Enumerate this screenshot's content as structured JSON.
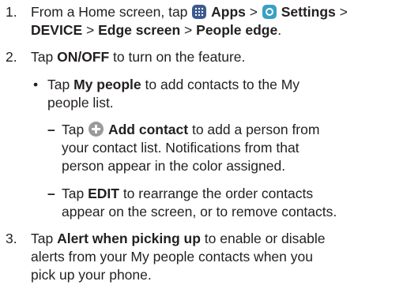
{
  "step1": {
    "number": "1.",
    "t1": "From a Home screen, tap",
    "apps": "Apps",
    "gt1": " > ",
    "settings": "Settings",
    "gt2": " >",
    "device": "DEVICE",
    "gt3": " > ",
    "edge_screen": "Edge screen",
    "gt4": " > ",
    "people_edge": "People edge",
    "period": "."
  },
  "step2": {
    "number": "2.",
    "t1": "Tap ",
    "onoff": "ON/OFF",
    "t2": " to turn on the feature."
  },
  "bullet": {
    "marker": "•",
    "t1": "Tap ",
    "my_people": "My people",
    "t2": " to add contacts to the My",
    "line2": "people list."
  },
  "sub1": {
    "marker": "–",
    "t1": "Tap",
    "add_contact": "Add contact",
    "t2": " to add a person from",
    "line2": "your contact list. Notifications from that",
    "line3": "person appear in the color assigned."
  },
  "sub2": {
    "marker": "–",
    "t1": "Tap ",
    "edit": "EDIT",
    "t2": " to rearrange the order contacts",
    "line2": "appear on the screen, or to remove contacts."
  },
  "step3": {
    "number": "3.",
    "t1": "Tap ",
    "alert": "Alert when picking up",
    "t2": " to enable or disable",
    "line2": "alerts from your My people contacts when you",
    "line3": "pick up your phone."
  }
}
